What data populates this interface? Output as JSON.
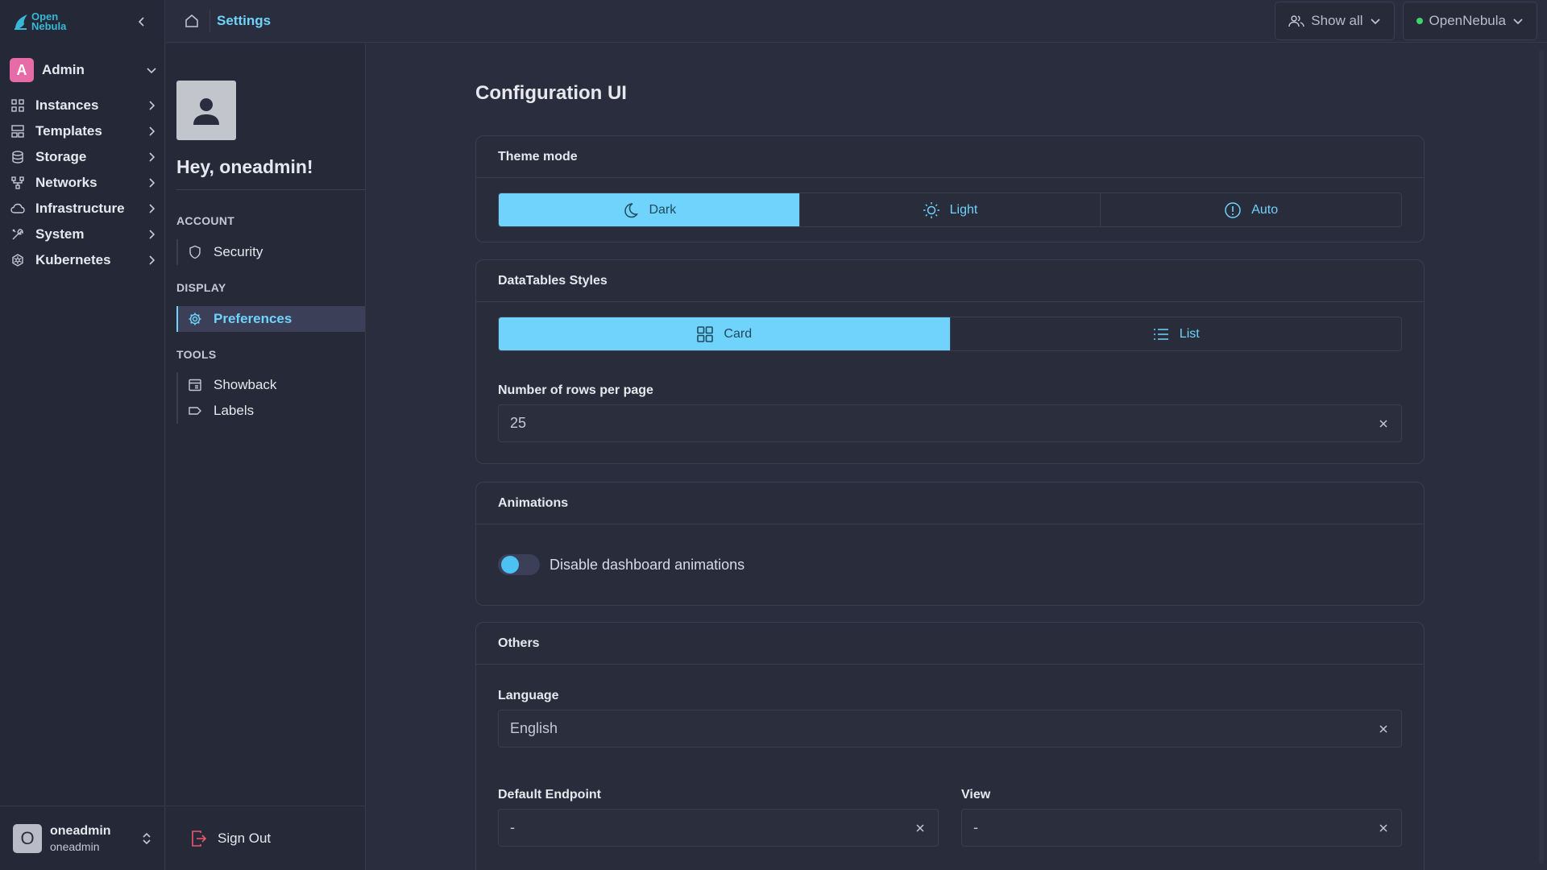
{
  "app": {
    "logo_line1": "Open",
    "logo_line2": "Nebula"
  },
  "nav": {
    "group": {
      "initial": "A",
      "name": "Admin"
    },
    "items": [
      {
        "label": "Instances",
        "icon": "instances-icon"
      },
      {
        "label": "Templates",
        "icon": "templates-icon"
      },
      {
        "label": "Storage",
        "icon": "storage-icon"
      },
      {
        "label": "Networks",
        "icon": "networks-icon"
      },
      {
        "label": "Infrastructure",
        "icon": "cloud-icon"
      },
      {
        "label": "System",
        "icon": "tools-icon"
      },
      {
        "label": "Kubernetes",
        "icon": "kubernetes-icon"
      }
    ],
    "user": {
      "initial": "O",
      "name": "oneadmin",
      "sub": "oneadmin"
    }
  },
  "topbar": {
    "breadcrumb": "Settings",
    "show_all_label": "Show all",
    "zone_label": "OpenNebula",
    "zone_status_color": "#3dd56a"
  },
  "settings_sidebar": {
    "greeting": "Hey, oneadmin!",
    "sections": [
      {
        "title": "ACCOUNT",
        "items": [
          {
            "label": "Security",
            "icon": "shield-icon"
          }
        ]
      },
      {
        "title": "DISPLAY",
        "items": [
          {
            "label": "Preferences",
            "icon": "gear-icon",
            "active": true
          }
        ]
      },
      {
        "title": "TOOLS",
        "items": [
          {
            "label": "Showback",
            "icon": "showback-icon"
          },
          {
            "label": "Labels",
            "icon": "label-icon"
          }
        ]
      }
    ],
    "signout_label": "Sign Out"
  },
  "main": {
    "title": "Configuration UI",
    "theme": {
      "heading": "Theme mode",
      "options": [
        "Dark",
        "Light",
        "Auto"
      ],
      "selected": "Dark"
    },
    "datatables": {
      "heading": "DataTables Styles",
      "options": [
        "Card",
        "List"
      ],
      "selected": "Card",
      "rows_label": "Number of rows per page",
      "rows_value": "25"
    },
    "animations": {
      "heading": "Animations",
      "toggle_label": "Disable dashboard animations"
    },
    "others": {
      "heading": "Others",
      "language_label": "Language",
      "language_value": "English",
      "endpoint_label": "Default Endpoint",
      "endpoint_value": "-",
      "view_label": "View",
      "view_value": "-"
    }
  },
  "colors": {
    "accent": "#6fd3fb",
    "background": "#2a2d3d",
    "group_avatar": "#e66ba6",
    "signout_icon": "#f0566e"
  }
}
